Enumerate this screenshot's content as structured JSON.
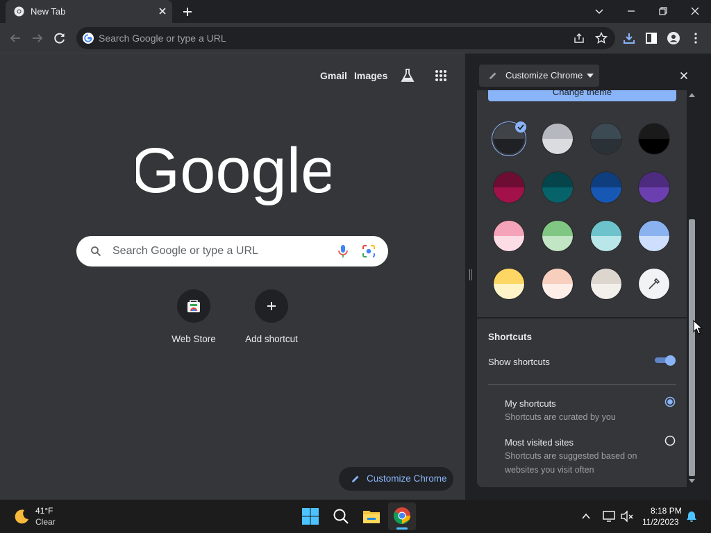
{
  "tab": {
    "title": "New Tab"
  },
  "omnibox": {
    "placeholder": "Search Google or type a URL"
  },
  "ntp": {
    "links": {
      "gmail": "Gmail",
      "images": "Images"
    },
    "search_placeholder": "Search Google or type a URL",
    "logo_text": "Google",
    "shortcuts": [
      {
        "label": "Web Store"
      },
      {
        "label": "Add shortcut"
      }
    ],
    "customize_button": "Customize Chrome"
  },
  "side_panel": {
    "title": "Customize Chrome",
    "change_theme_button": "Change theme",
    "color_swatches": [
      {
        "name": "default-dark",
        "top": "#404348",
        "bottom": "#202124",
        "selected": true
      },
      {
        "name": "grey",
        "top": "#b5b8be",
        "bottom": "#dadce0",
        "selected": false
      },
      {
        "name": "cool-grey",
        "top": "#3c4a54",
        "bottom": "#2a3137",
        "selected": false
      },
      {
        "name": "black",
        "top": "#1a1a1a",
        "bottom": "#000000",
        "selected": false
      },
      {
        "name": "crimson",
        "top": "#6d0d33",
        "bottom": "#a3114b",
        "selected": false
      },
      {
        "name": "teal",
        "top": "#04444a",
        "bottom": "#06636a",
        "selected": false
      },
      {
        "name": "navy",
        "top": "#0f3e7f",
        "bottom": "#1758b4",
        "selected": false
      },
      {
        "name": "violet",
        "top": "#4d2b7f",
        "bottom": "#6c3fb0",
        "selected": false
      },
      {
        "name": "pink",
        "top": "#f5a3b8",
        "bottom": "#fcdde6",
        "selected": false
      },
      {
        "name": "green",
        "top": "#81c784",
        "bottom": "#c2e5c3",
        "selected": false
      },
      {
        "name": "aqua",
        "top": "#6cc3cb",
        "bottom": "#b9e6e9",
        "selected": false
      },
      {
        "name": "light-blue",
        "top": "#8ab2f1",
        "bottom": "#cddffc",
        "selected": false
      },
      {
        "name": "yellow",
        "top": "#fdd663",
        "bottom": "#fff4c7",
        "selected": false
      },
      {
        "name": "peach",
        "top": "#f8cfbe",
        "bottom": "#fdeee7",
        "selected": false
      },
      {
        "name": "beige",
        "top": "#ddd6cf",
        "bottom": "#f3efeb",
        "selected": false
      },
      {
        "name": "custom-color-picker",
        "top": "#f1f3f4",
        "bottom": "#f1f3f4",
        "selected": false
      }
    ],
    "shortcuts": {
      "section_title": "Shortcuts",
      "toggle_label": "Show shortcuts",
      "toggle_on": true,
      "options": [
        {
          "label": "My shortcuts",
          "description": "Shortcuts are curated by you",
          "checked": true
        },
        {
          "label": "Most visited sites",
          "description": "Shortcuts are suggested based on websites you visit often",
          "checked": false
        }
      ]
    }
  },
  "taskbar": {
    "weather": {
      "temp": "41°F",
      "condition": "Clear"
    },
    "clock": {
      "time": "8:18 PM",
      "date": "11/2/2023"
    }
  },
  "colors": {
    "accent": "#8ab4f8",
    "panel_bg": "#35363a",
    "frame_bg": "#202124"
  }
}
